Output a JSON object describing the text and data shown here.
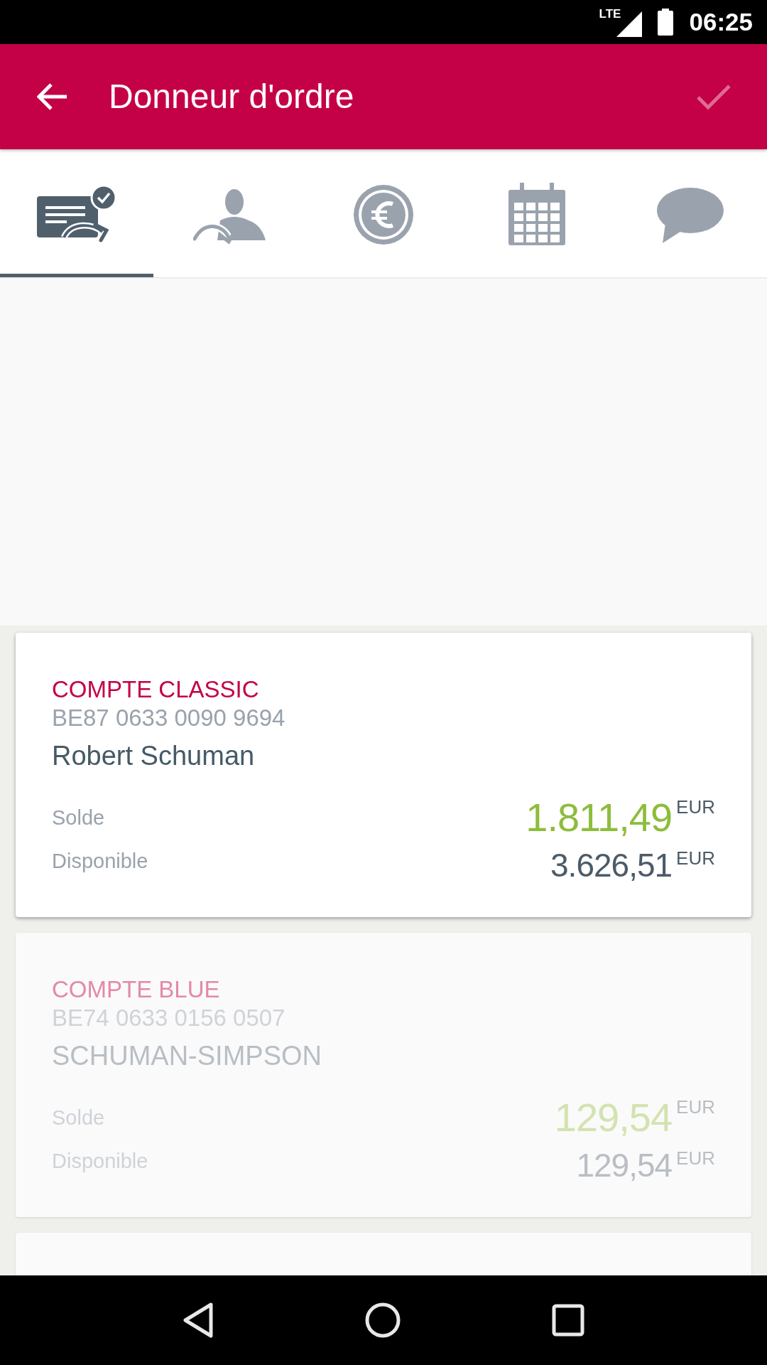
{
  "status_bar": {
    "network": "LTE",
    "time": "06:25"
  },
  "app_bar": {
    "title": "Donneur d'ordre"
  },
  "tabs": [
    {
      "kind": "transfer",
      "selected": true
    },
    {
      "kind": "beneficiary",
      "selected": false
    },
    {
      "kind": "amount",
      "selected": false
    },
    {
      "kind": "date",
      "selected": false
    },
    {
      "kind": "message",
      "selected": false
    }
  ],
  "accounts": [
    {
      "type": "COMPTE CLASSIC",
      "iban": "BE87 0633 0090 9694",
      "holder": "Robert Schuman",
      "selected": true,
      "rows": [
        {
          "label": "Solde",
          "amount": "1.811,49",
          "currency": "EUR",
          "kind": "balance"
        },
        {
          "label": "Disponible",
          "amount": "3.626,51",
          "currency": "EUR",
          "kind": "available"
        }
      ]
    },
    {
      "type": "COMPTE BLUE",
      "iban": "BE74 0633 0156 0507",
      "holder": "SCHUMAN-SIMPSON",
      "selected": false,
      "rows": [
        {
          "label": "Solde",
          "amount": "129,54",
          "currency": "EUR",
          "kind": "balance"
        },
        {
          "label": "Disponible",
          "amount": "129,54",
          "currency": "EUR",
          "kind": "available"
        }
      ]
    },
    {
      "selected": false
    }
  ]
}
